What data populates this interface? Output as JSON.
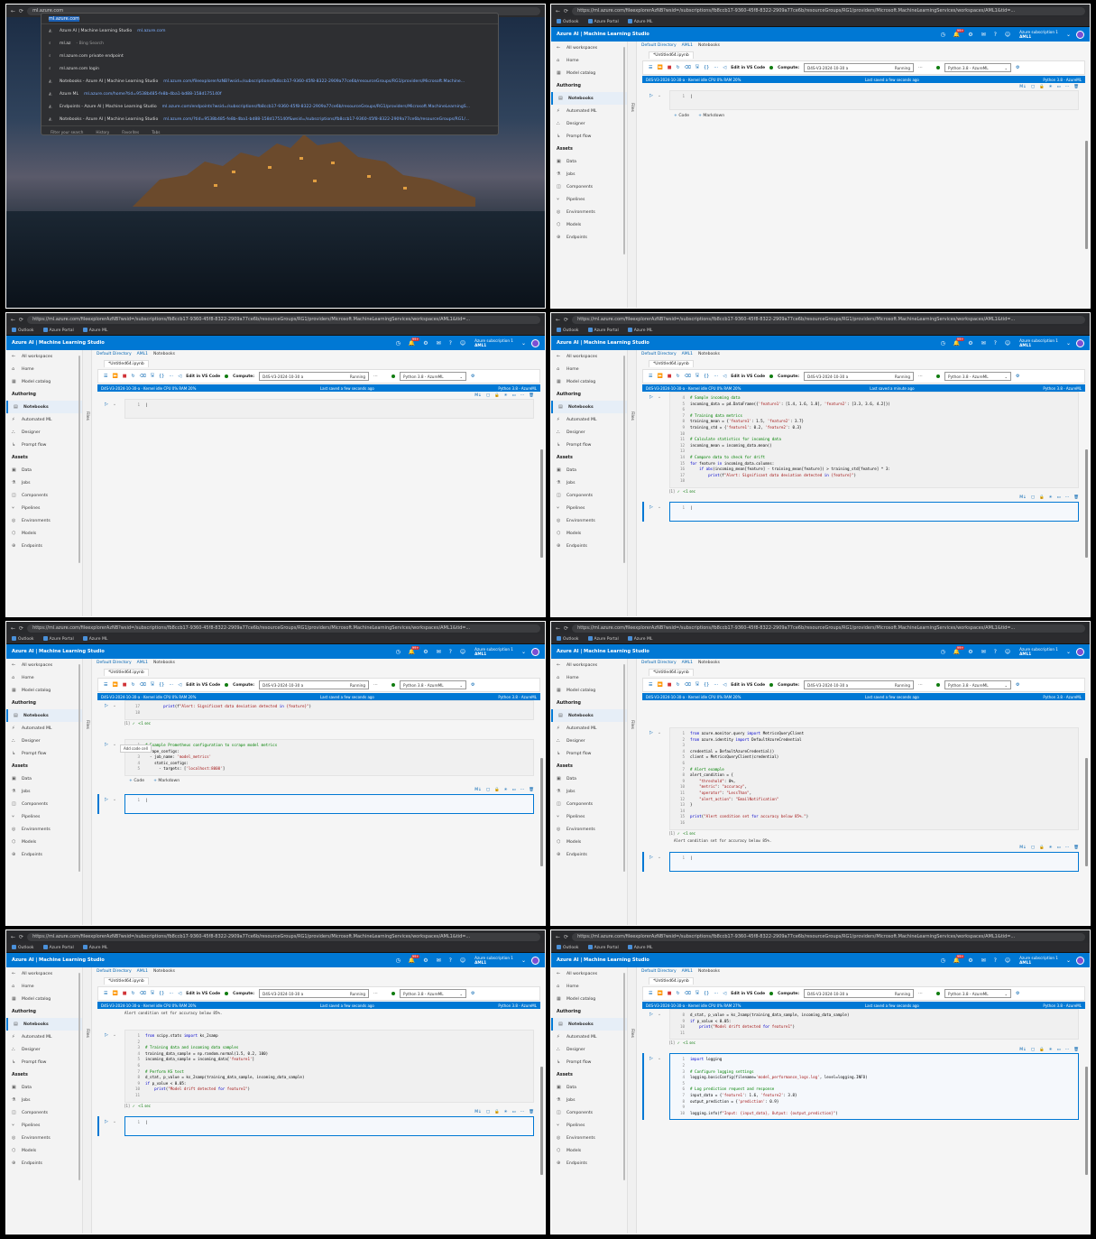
{
  "browser": {
    "url": "https://ml.azure.com/fileexplorerAzNB?wsid=/subscriptions/fb8ccb17-9360-45f8-8322-2909a77ce6b/resourceGroups/RG1/providers/Microsoft.MachineLearningServices/workspaces/AML1&tid=...",
    "bookmarks": [
      "Outlook",
      "Azure Portal",
      "Azure ML"
    ]
  },
  "azure": {
    "brand": "Azure AI | Machine Learning Studio",
    "badge": "99+",
    "subscription": "Azure subscription 1",
    "workspace": "AML1"
  },
  "sidebar": {
    "all_workspaces": "All workspaces",
    "home": "Home",
    "model_catalog": "Model catalog",
    "authoring": "Authoring",
    "notebooks": "Notebooks",
    "automated_ml": "Automated ML",
    "designer": "Designer",
    "prompt_flow": "Prompt flow",
    "assets": "Assets",
    "data": "Data",
    "jobs": "Jobs",
    "components": "Components",
    "pipelines": "Pipelines",
    "environments": "Environments",
    "models": "Models",
    "endpoints": "Endpoints"
  },
  "files_label": "Files",
  "breadcrumb": {
    "dir": "Default Directory",
    "ws": "AML1",
    "nb": "Notebooks"
  },
  "file_tab": "*Untitled64.ipynb",
  "toolbar": {
    "edit_vscode": "Edit in VS Code",
    "compute": "Compute:",
    "compute_name": "D4S-V3-2024-10-30 a",
    "compute_state": "Running",
    "kernel": "Python 3.8 - AzureML"
  },
  "status": {
    "left": "D4S-V3-2024-10-30-a · Kernel idle  CPU  0%   RAM 20%",
    "left27": "D4S-V3-2024-10-30-a · Kernel idle  CPU  0%   RAM 27%",
    "saved_few": "Last saved a few seconds ago",
    "saved_min": "Last saved a minute ago",
    "kernel": "Python 3.8 - AzureML"
  },
  "add_code": "Code",
  "add_markdown": "Markdown",
  "tooltip_add_code": "Add code cell",
  "ran": "<1 sec",
  "desktop": {
    "address_typed": "ml.azure.com",
    "suggestions": [
      {
        "t": "Azure AI | Machine Learning Studio",
        "u": "ml.azure.com"
      },
      {
        "t": "ml.az",
        "u": "- Bing Search"
      },
      {
        "t": "ml.azure.com private endpoint",
        "u": ""
      },
      {
        "t": "ml.azure.com login",
        "u": ""
      },
      {
        "t": "Notebooks - Azure AI | Machine Learning Studio",
        "u": "ml.azure.com/fileexplorerAzNB?wsid=/subscriptions/fb8ccb17-9360-45f8-8322-2909a77ce6b/resourceGroups/RG1/providers/Microsoft.Machine..."
      },
      {
        "t": "Azure ML",
        "u": "ml.azure.com/home?tid=9538b485-fe8b-4ba1-bd88-158d175140f"
      },
      {
        "t": "Endpoints - Azure AI | Machine Learning Studio",
        "u": "ml.azure.com/endpoints?wsid=/subscriptions/fb8ccb17-9360-45f8-8322-2909a77ce6b/resourceGroups/RG1/providers/Microsoft.MachineLearningS..."
      },
      {
        "t": "Notebooks - Azure AI | Machine Learning Studio",
        "u": "ml.azure.com/?tid=9538b485-fe8b-4ba1-bd88-158d175140f&wsid=/subscriptions/fb8ccb17-9360-45f8-8322-2909a77ce6b/resourceGroups/RG1/..."
      }
    ],
    "footer": [
      "Filter your search",
      "History",
      "Favorites",
      "Tabs"
    ]
  },
  "cells": {
    "empty_line": "1",
    "drift": [
      [
        "4",
        "# Sample incoming data"
      ],
      [
        "5",
        "incoming_data = pd.DataFrame({'feature1': [1.4, 1.6, 1.8], 'feature2': [3.3, 3.6, 4.2]})"
      ],
      [
        "6",
        ""
      ],
      [
        "7",
        "# Training data metrics"
      ],
      [
        "8",
        "training_mean = {'feature1': 1.5, 'feature2': 3.7}"
      ],
      [
        "9",
        "training_std = {'feature1': 0.2, 'feature2': 0.3}"
      ],
      [
        "10",
        ""
      ],
      [
        "11",
        "# Calculate statistics for incoming data"
      ],
      [
        "12",
        "incoming_mean = incoming_data.mean()"
      ],
      [
        "13",
        ""
      ],
      [
        "14",
        "# Compare data to check for drift"
      ],
      [
        "15",
        "for feature in incoming_data.columns:"
      ],
      [
        "16",
        "    if abs(incoming_mean[feature] - training_mean[feature]) > training_std[feature] * 3:"
      ],
      [
        "17",
        "        print(f\"Alert: Significant data deviation detected in {feature}\")"
      ],
      [
        "18",
        ""
      ]
    ],
    "prom_prev": [
      [
        "17",
        "        print(f\"Alert: Significant data deviation detected in {feature}\")"
      ],
      [
        "18",
        ""
      ]
    ],
    "prom": [
      [
        "1",
        "# Example Prometheus configuration to scrape model metrics"
      ],
      [
        "2",
        "scrape_configs:"
      ],
      [
        "3",
        "  - job_name: 'model_metrics'"
      ],
      [
        "4",
        "    static_configs:"
      ],
      [
        "5",
        "      - targets: ['localhost:8000']"
      ]
    ],
    "monitor": [
      [
        "1",
        "from azure.monitor.query import MetricsQueryClient"
      ],
      [
        "2",
        "from azure.identity import DefaultAzureCredential"
      ],
      [
        "3",
        ""
      ],
      [
        "4",
        "credential = DefaultAzureCredential()"
      ],
      [
        "5",
        "client = MetricsQueryClient(credential)"
      ],
      [
        "6",
        ""
      ],
      [
        "7",
        "# Alert example"
      ],
      [
        "8",
        "alert_condition = {"
      ],
      [
        "9",
        "    \"threshold\": 0%,"
      ],
      [
        "10",
        "    \"metric\": \"accuracy\","
      ],
      [
        "11",
        "    \"operator\": \"LessThan\","
      ],
      [
        "12",
        "    \"alert_action\": \"EmailNotification\""
      ],
      [
        "13",
        "}"
      ],
      [
        "14",
        ""
      ],
      [
        "15",
        "print(\"Alert condition set for accuracy below 85%.\")"
      ],
      [
        "16",
        ""
      ]
    ],
    "monitor_out": "Alert condition set for accuracy below 85%.",
    "ks": [
      [
        "1",
        "from scipy.stats import ks_2samp"
      ],
      [
        "2",
        ""
      ],
      [
        "3",
        "# Training data and incoming data samples"
      ],
      [
        "4",
        "training_data_sample = np.random.normal(1.5, 0.2, 100)"
      ],
      [
        "5",
        "incoming_data_sample = incoming_data['feature1']"
      ],
      [
        "6",
        ""
      ],
      [
        "7",
        "# Perform KS test"
      ],
      [
        "8",
        "d_stat, p_value = ks_2samp(training_data_sample, incoming_data_sample)"
      ],
      [
        "9",
        "if p_value < 0.05:"
      ],
      [
        "10",
        "    print(\"Model drift detected for feature1\")"
      ],
      [
        "11",
        ""
      ]
    ],
    "ks_prev": [
      [
        "8",
        "d_stat, p_value = ks_2samp(training_data_sample, incoming_data_sample)"
      ],
      [
        "9",
        "if p_value < 0.05:"
      ],
      [
        "10",
        "    print(\"Model drift detected for feature1\")"
      ],
      [
        "11",
        ""
      ]
    ],
    "logging": [
      [
        "1",
        "import logging"
      ],
      [
        "2",
        ""
      ],
      [
        "3",
        "# Configure logging settings"
      ],
      [
        "4",
        "logging.basicConfig(filename='model_performance_logs.log', level=logging.INFO)"
      ],
      [
        "5",
        ""
      ],
      [
        "6",
        "# Log prediction request and response"
      ],
      [
        "7",
        "input_data = {'feature1': 1.6, 'feature2': 3.8}"
      ],
      [
        "8",
        "output_prediction = {'prediction': 0.9}"
      ],
      [
        "9",
        ""
      ],
      [
        "10",
        "logging.info(f\"Input: {input_data}, Output: {output_prediction}\")"
      ]
    ]
  },
  "colors": {
    "azure_blue": "#0078d4",
    "status_blue": "#0078d4",
    "chrome_dark": "#292a2d"
  }
}
